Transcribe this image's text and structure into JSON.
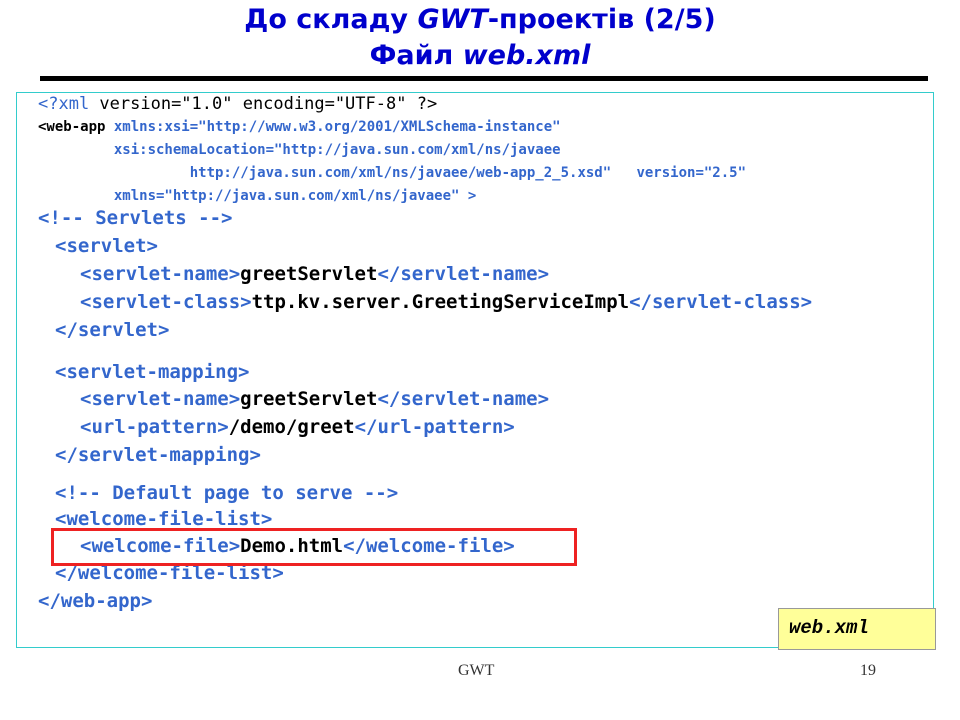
{
  "title": {
    "line1_a": "До складу ",
    "line1_em": "GWT",
    "line1_b": "-проектів (2/5)",
    "line2_a": "Файл ",
    "line2_em": "web.xml"
  },
  "code": {
    "l1": {
      "tag_a": "<?xml",
      "rest": " version=\"1.0\" encoding=\"UTF-8\" ?>"
    },
    "l2": {
      "tag_a": "<web-app",
      "rest": " xmlns:xsi=\"http://www.w3.org/2001/XMLSchema-instance\""
    },
    "l3": {
      "rest": "         xsi:schemaLocation=\"http://java.sun.com/xml/ns/javaee"
    },
    "l4": {
      "rest": "                  http://java.sun.com/xml/ns/javaee/web-app_2_5.xsd\"   version=\"2.5\""
    },
    "l5": {
      "rest": "         xmlns=\"http://java.sun.com/xml/ns/javaee\" >"
    },
    "l6": {
      "tag": "<!-- Servlets -->"
    },
    "l7": {
      "tag": "<servlet>"
    },
    "l8": {
      "tag_a": "<servlet-name>",
      "text": "greetServlet",
      "tag_b": "</servlet-name>"
    },
    "l9": {
      "tag_a": "<servlet-class>",
      "text": "ttp.kv.server.GreetingServiceImpl",
      "tag_b": "</servlet-class>"
    },
    "l10": {
      "tag": "</servlet>"
    },
    "l11": {
      "tag": "<servlet-mapping>"
    },
    "l12": {
      "tag_a": "<servlet-name>",
      "text": "greetServlet",
      "tag_b": "</servlet-name>"
    },
    "l13": {
      "tag_a": "<url-pattern>",
      "text": "/demo/greet",
      "tag_b": "</url-pattern>"
    },
    "l14": {
      "tag": "</servlet-mapping>"
    },
    "l15": {
      "tag": "<!-- Default page to serve -->"
    },
    "l16": {
      "tag": "<welcome-file-list>"
    },
    "l17": {
      "tag_a": "<welcome-file>",
      "text": "Demo.html",
      "tag_b": "</welcome-file>"
    },
    "l18": {
      "tag": "</welcome-file-list>"
    },
    "l19": {
      "tag": "</web-app>"
    }
  },
  "badge": "web.xml",
  "footer": {
    "center": "GWT",
    "page": "19"
  },
  "colors": {
    "title": "#0000cc",
    "tag": "#3366cc",
    "highlight_border": "#ee2222",
    "badge_bg": "#ffff99",
    "box_border": "#33cccc"
  }
}
